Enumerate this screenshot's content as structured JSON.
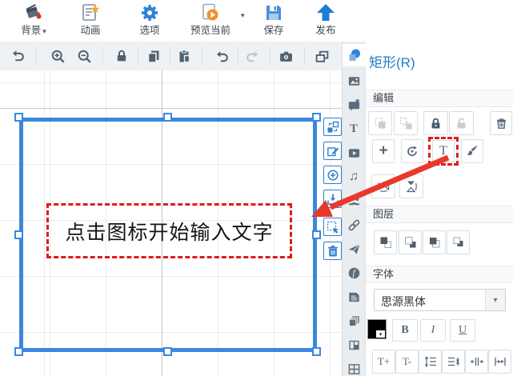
{
  "glyphs": {
    "caret": "▾",
    "plus": "+",
    "music_note": "♫",
    "text_tool": "T",
    "flash_f": "f"
  },
  "top_toolbar": {
    "items": [
      {
        "label": "背景",
        "icon": "paint-bucket-icon",
        "has_menu": true
      },
      {
        "label": "动画",
        "icon": "animation-icon",
        "has_menu": false
      },
      {
        "label": "选项",
        "icon": "options-gear-icon",
        "has_menu": false
      },
      {
        "label": "预览当前",
        "icon": "preview-play-icon",
        "has_menu": true
      },
      {
        "label": "保存",
        "icon": "save-icon",
        "has_menu": false
      },
      {
        "label": "发布",
        "icon": "publish-icon",
        "has_menu": false
      }
    ]
  },
  "quick_toolbar": {
    "icons": [
      "reset-view",
      "zoom-in",
      "zoom-out",
      "lock",
      "copy",
      "paste",
      "undo",
      "redo",
      "screenshot",
      "new-window"
    ],
    "disabled": [
      "redo"
    ]
  },
  "canvas": {
    "grid": true,
    "selected_shape": "rectangle",
    "placeholder_text": "点击图标开始输入文字"
  },
  "shape_toolbar": {
    "icons": [
      "swap-shape",
      "edit-shape",
      "zoom-to-shape",
      "import-to-shape",
      "select-region",
      "delete-shape"
    ]
  },
  "sidebar_tabs": [
    "shapes",
    "image",
    "whiteboard",
    "text",
    "video",
    "music",
    "roles",
    "link",
    "camera-path",
    "flash",
    "notes",
    "pages",
    "layout",
    "grid"
  ],
  "panel": {
    "title": "矩形(R)",
    "edit": {
      "header": "编辑",
      "buttons": [
        "group",
        "ungroup",
        "lock",
        "unlock",
        "delete",
        "add",
        "rotate-animation",
        "text",
        "format-brush",
        "flip-horizontal",
        "flip-vertical"
      ],
      "highlighted_button": "text"
    },
    "layer": {
      "header": "图层",
      "buttons": [
        "bring-to-front",
        "send-to-back",
        "bring-forward",
        "send-backward"
      ]
    },
    "font": {
      "header": "字体",
      "family": "思源黑体",
      "bold": "B",
      "italic": "I",
      "underline": "U",
      "size_up": "T+",
      "size_down": "T-",
      "buttons": [
        "font-color",
        "bold",
        "italic",
        "underline",
        "increase-size",
        "decrease-size",
        "line-spacing-increase",
        "line-spacing-decrease",
        "char-spacing-increase",
        "char-spacing-decrease"
      ]
    }
  },
  "colors": {
    "accent_blue": "#2f7fd0",
    "selection_blue": "#3a87de",
    "highlight_red": "#e01b1b",
    "arrow_red": "#e8392b"
  }
}
